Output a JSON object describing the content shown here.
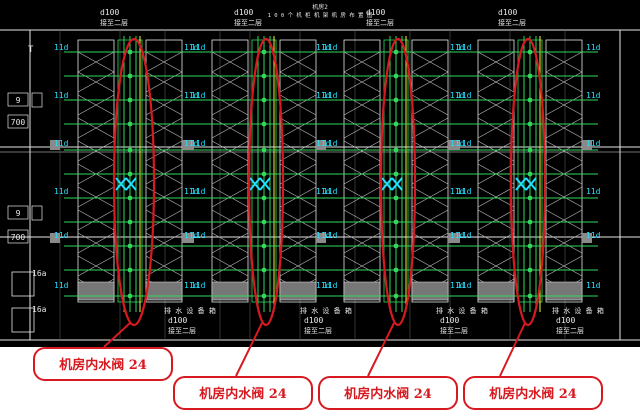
{
  "drawing": {
    "background": "#000000",
    "title_lines": [
      "机房2",
      "1 0 0 个 机 柜 机 架 机 房 布 置 图"
    ],
    "pipe_labels_top": [
      {
        "size": "d100",
        "note": "接至二层"
      },
      {
        "size": "d100",
        "note": "接至二层"
      },
      {
        "size": "d100",
        "note": "接至二层"
      },
      {
        "size": "d100",
        "note": "接至二层"
      }
    ],
    "pipe_labels_bottom": [
      {
        "device": "排 水 设 备 箱",
        "size": "d100",
        "note": "接至二层"
      },
      {
        "device": "排 水 设 备 箱",
        "size": "d100",
        "note": "接至二层"
      },
      {
        "device": "排 水 设 备 箱",
        "size": "d100",
        "note": "接至二层"
      }
    ],
    "branch_label": "11d",
    "branch_label_alt": "11d",
    "left_dims": [
      "9",
      "700",
      "9",
      "700"
    ],
    "left_room_labels": [
      "16a",
      "16a"
    ],
    "top_left_mark": "T",
    "colors": {
      "cyan": "#22e0ff",
      "green": "#31d85a",
      "yellow": "#f2f23a",
      "white": "#e6e6e6",
      "red": "#d71920",
      "grey": "#8a8a8a"
    }
  },
  "callouts": [
    {
      "text": "机房内水阀 24"
    },
    {
      "text": "机房内水阀 24"
    },
    {
      "text": "机房内水阀 24"
    },
    {
      "text": "机房内水阀 24"
    }
  ]
}
